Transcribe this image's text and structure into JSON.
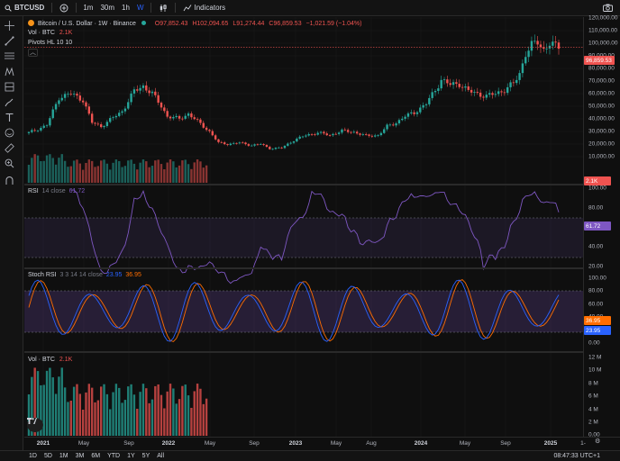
{
  "topbar": {
    "symbol": "BTCUSD",
    "intervals": [
      "1m",
      "30m",
      "1h",
      "W"
    ],
    "indicators_label": "Indicators"
  },
  "price_pane": {
    "title": "Bitcoin / U.S. Dollar · 1W · Binance",
    "ohlc": {
      "o": "O97,852.43",
      "h": "H102,094.65",
      "l": "L91,274.44",
      "c": "C96,859.53",
      "chg": "−1,021.59 (−1.04%)"
    },
    "vol_legend": {
      "label": "Vol · BTC",
      "value": "2.1K"
    },
    "pivots_label": "Pivots HL 10 10",
    "last_price": "96,859.53",
    "vol_tag": "2.1K",
    "yticks": [
      "120,000.00",
      "110,000.00",
      "100,000.00",
      "90,000.00",
      "80,000.00",
      "70,000.00",
      "60,000.00",
      "50,000.00",
      "40,000.00",
      "30,000.00",
      "20,000.00",
      "10,000.00"
    ]
  },
  "rsi_pane": {
    "label": "RSI",
    "params": "14 close",
    "value": "61.72",
    "yticks": [
      "100.00",
      "80.00",
      "40.00",
      "20.00"
    ],
    "tag": "61.72"
  },
  "stoch_pane": {
    "label": "Stoch RSI",
    "params": "3 3 14 14 close",
    "k": "23.95",
    "d": "36.95",
    "yticks": [
      "100.00",
      "80.00",
      "60.00",
      "40.00",
      "20.00",
      "0.00"
    ],
    "tag_d": "36.95",
    "tag_k": "23.95"
  },
  "vol_pane": {
    "label": "Vol · BTC",
    "value": "2.1K",
    "yticks": [
      "12 M",
      "10 M",
      "8 M",
      "6 M",
      "4 M",
      "2 M",
      "0.00"
    ]
  },
  "xaxis": {
    "labels": [
      "2021",
      "May",
      "Sep",
      "2022",
      "May",
      "Sep",
      "2023",
      "May",
      "Aug",
      "2024",
      "May",
      "Sep",
      "2025"
    ],
    "cursor_label": "1-"
  },
  "bottombar": {
    "ranges": [
      "1D",
      "5D",
      "1M",
      "3M",
      "6M",
      "YTD",
      "1Y",
      "5Y",
      "All"
    ],
    "clock": "08:47:33 UTC+1"
  },
  "colors": {
    "up": "#26a69a",
    "down": "#ef5350",
    "rsi": "#7e57c2",
    "stoch_k": "#2962ff",
    "stoch_d": "#ff6d00",
    "accent": "#2962ff"
  }
}
